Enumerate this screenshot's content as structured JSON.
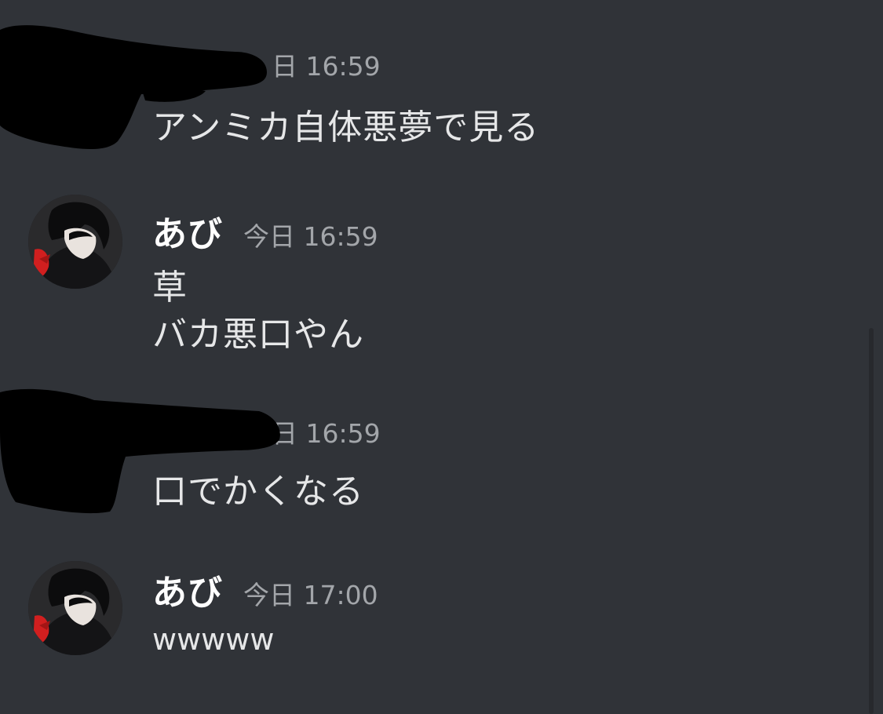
{
  "messages": [
    {
      "author": "",
      "timestamp": "日 16:59",
      "lines": [
        "アンミカ自体悪夢で見る"
      ],
      "redacted": true
    },
    {
      "author": "あび",
      "timestamp": "今日 16:59",
      "lines": [
        "草",
        "バカ悪口やん"
      ],
      "redacted": false
    },
    {
      "author": "",
      "timestamp": "日 16:59",
      "lines": [
        "口でかくなる"
      ],
      "redacted": true
    },
    {
      "author": "あび",
      "timestamp": "今日 17:00",
      "lines": [
        "wwwww"
      ],
      "redacted": false
    }
  ],
  "colors": {
    "background": "#303338",
    "username": "#ffffff",
    "message_text": "#e6e7e8",
    "timestamp": "#a3a6aa",
    "redaction": "#000000",
    "avatar_accent": "#d11f1f"
  },
  "icons": {
    "avatar": "anime-character-avatar-icon"
  }
}
